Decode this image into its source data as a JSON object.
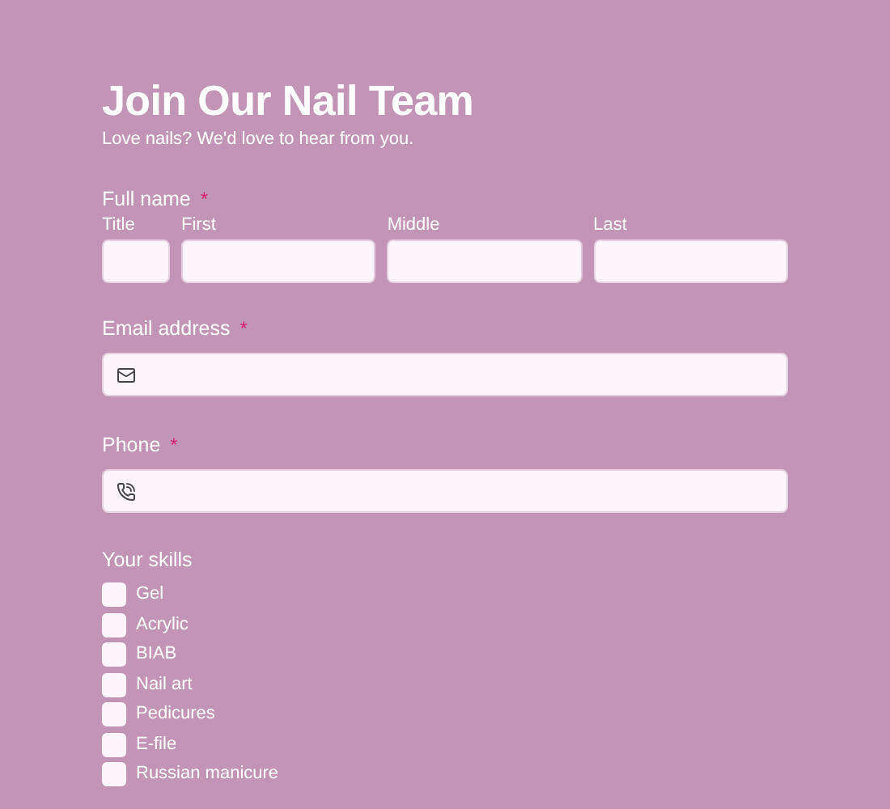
{
  "title": "Join Our Nail Team",
  "subtitle": "Love nails? We'd love to hear from you.",
  "full_name": {
    "label": "Full name",
    "required_mark": "*",
    "parts": [
      {
        "label": "Title"
      },
      {
        "label": "First"
      },
      {
        "label": "Middle"
      },
      {
        "label": "Last"
      }
    ]
  },
  "email": {
    "label": "Email address",
    "required_mark": "*"
  },
  "phone": {
    "label": "Phone",
    "required_mark": "*"
  },
  "skills": {
    "label": "Your skills",
    "options": [
      {
        "label": "Gel",
        "checked": false
      },
      {
        "label": "Acrylic",
        "checked": false
      },
      {
        "label": "BIAB",
        "checked": false
      },
      {
        "label": "Nail art",
        "checked": false
      },
      {
        "label": "Pedicures",
        "checked": false
      },
      {
        "label": "E-file",
        "checked": false
      },
      {
        "label": "Russian manicure",
        "checked": false
      }
    ]
  }
}
